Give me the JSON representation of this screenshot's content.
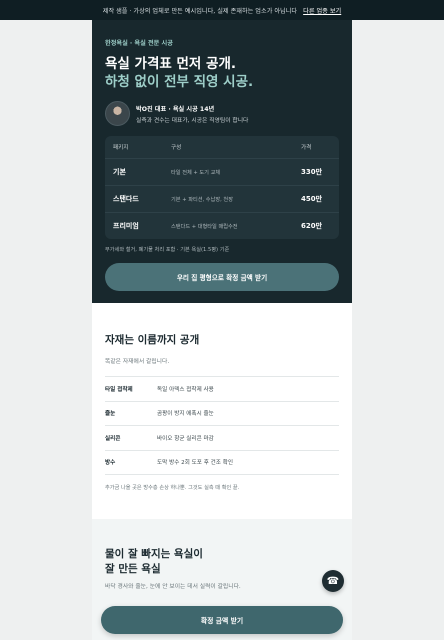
{
  "banner": {
    "text": "제작 샘플 · 가상의 업체로 만든 예시입니다, 실제 존재하는 업소가 아닙니다",
    "link": "다른 업종 보기"
  },
  "hero": {
    "eyebrow": "한정욕실 · 욕실 전문 시공",
    "title_line1": "욕실 가격표 먼저 공개.",
    "title_line2": "하청 없이 전부 직영 시공.",
    "profile_name": "박O진 대표 · 욕실 시공 14년",
    "profile_desc": "실측과 견수는 대표가, 시공은 직영팀이 합니다",
    "table_header": {
      "package": "패키지",
      "config": "구성",
      "price": "가격"
    },
    "packages": [
      {
        "name": "기본",
        "config": "타일 전체 + 도기 교체",
        "price": "330만"
      },
      {
        "name": "스탠다드",
        "config": "기본 + 파티션, 수납장, 천장",
        "price": "450만"
      },
      {
        "name": "프리미엄",
        "config": "스탠다드 + 대형타일 매립수전",
        "price": "620만"
      }
    ],
    "note": "부가세와 철거, 폐기물 처리 포함 · 기본 욕실(1.5평) 기준",
    "cta": "우리 집 평형으로 확정 금액 받기"
  },
  "materials": {
    "title": "자재는 이름까지 공개",
    "subtitle": "똑같은 자재에서 갈립니다.",
    "rows": [
      {
        "key": "타일 접착제",
        "value": "독일 아덱스 접착제 사용"
      },
      {
        "key": "줄눈",
        "value": "곰팡이 방지 에폭시 줄눈"
      },
      {
        "key": "실리콘",
        "value": "바이오 항균 실리콘 마감"
      },
      {
        "key": "방수",
        "value": "도막 방수 2회 도포 후 건조 확인"
      }
    ],
    "note": "추가금 나올 곳은 방수층 손상 하나뿐. 그것도 실측 때 확인 끝."
  },
  "drain": {
    "title_line1": "물이 잘 빠지는 욕실이",
    "title_line2": "잘 만든 욕실",
    "subtitle": "바닥 경사와 줄눈, 눈에 안 보이는 데서 실력이 갈립니다."
  },
  "fab_icon": "phone-icon",
  "sticky_cta": "확정 금액 받기"
}
